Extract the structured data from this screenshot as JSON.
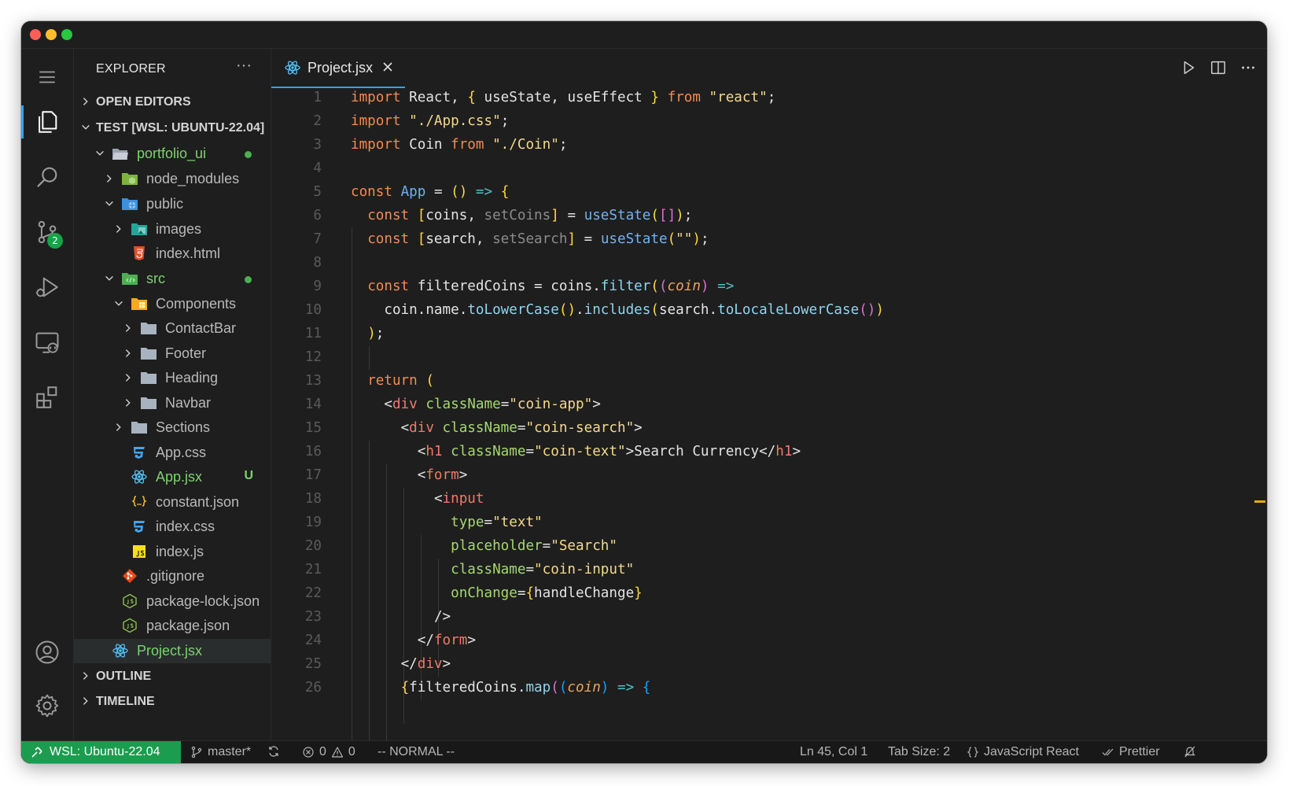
{
  "window": {
    "controls": [
      "close",
      "minimize",
      "maximize"
    ]
  },
  "activity_bar": {
    "items": [
      {
        "name": "menu-icon"
      },
      {
        "name": "explorer-icon",
        "active": true
      },
      {
        "name": "search-icon"
      },
      {
        "name": "source-control-icon",
        "badge": "2"
      },
      {
        "name": "run-debug-icon"
      },
      {
        "name": "remote-explorer-icon"
      },
      {
        "name": "extensions-icon"
      },
      {
        "name": "account-icon"
      },
      {
        "name": "settings-gear-icon"
      }
    ]
  },
  "sidebar": {
    "title": "EXPLORER",
    "more": "···",
    "open_editors": "OPEN EDITORS",
    "workspace": "TEST [WSL: UBUNTU-22.04]",
    "outline": "OUTLINE",
    "timeline": "TIMELINE",
    "tree": [
      {
        "label": "portfolio_ui",
        "icon": "folder-open-icon",
        "expanded": true,
        "dot": true
      },
      {
        "label": "node_modules",
        "icon": "node-folder-icon",
        "expanded": false
      },
      {
        "label": "public",
        "icon": "public-folder-icon",
        "expanded": true
      },
      {
        "label": "images",
        "icon": "images-folder-icon",
        "expanded": false
      },
      {
        "label": "index.html",
        "icon": "html-file-icon"
      },
      {
        "label": "src",
        "icon": "src-folder-icon",
        "expanded": true,
        "dot": true
      },
      {
        "label": "Components",
        "icon": "components-folder-icon",
        "expanded": true
      },
      {
        "label": "ContactBar",
        "icon": "folder-icon",
        "expanded": false
      },
      {
        "label": "Footer",
        "icon": "folder-icon",
        "expanded": false
      },
      {
        "label": "Heading",
        "icon": "folder-icon",
        "expanded": false
      },
      {
        "label": "Navbar",
        "icon": "folder-icon",
        "expanded": false
      },
      {
        "label": "Sections",
        "icon": "folder-icon",
        "expanded": false
      },
      {
        "label": "App.css",
        "icon": "css-file-icon"
      },
      {
        "label": "App.jsx",
        "icon": "react-file-icon",
        "status": "U"
      },
      {
        "label": "constant.json",
        "icon": "json-file-icon"
      },
      {
        "label": "index.css",
        "icon": "css-file-icon"
      },
      {
        "label": "index.js",
        "icon": "js-file-icon"
      },
      {
        "label": ".gitignore",
        "icon": "git-file-icon"
      },
      {
        "label": "package-lock.json",
        "icon": "npm-file-icon"
      },
      {
        "label": "package.json",
        "icon": "npm-file-icon"
      },
      {
        "label": "Project.jsx",
        "icon": "react-file-icon",
        "selected": true
      }
    ]
  },
  "editor": {
    "tab": {
      "label": "Project.jsx",
      "icon": "react-file-icon"
    },
    "toolbar": [
      "run-icon",
      "split-editor-icon",
      "more-actions-icon"
    ],
    "line_numbers": [
      "1",
      "2",
      "3",
      "4",
      "5",
      "6",
      "7",
      "8",
      "9",
      "10",
      "11",
      "12",
      "13",
      "14",
      "15",
      "16",
      "17",
      "18",
      "19",
      "20",
      "21",
      "22",
      "23",
      "24",
      "25",
      "26"
    ],
    "lines": [
      "import React, { useState, useEffect } from \"react\";",
      "import \"./App.css\";",
      "import Coin from \"./Coin\";",
      "",
      "const App = () => {",
      "  const [coins, setCoins] = useState([]);",
      "  const [search, setSearch] = useState(\"\");",
      "",
      "  const filteredCoins = coins.filter((coin) =>",
      "    coin.name.toLowerCase().includes(search.toLocaleLowerCase())",
      "  );",
      "",
      "  return (",
      "    <div className=\"coin-app\">",
      "      <div className=\"coin-search\">",
      "        <h1 className=\"coin-text\">Search Currency</h1>",
      "        <form>",
      "          <input",
      "            type=\"text\"",
      "            placeholder=\"Search\"",
      "            className=\"coin-input\"",
      "            onChange={handleChange}",
      "          />",
      "        </form>",
      "      </div>",
      "      {filteredCoins.map((coin) => {"
    ]
  },
  "status_bar": {
    "remote": "WSL: Ubuntu-22.04",
    "branch": "master*",
    "errors": "0",
    "warnings": "0",
    "vim_mode": "-- NORMAL --",
    "cursor": "Ln 45, Col 1",
    "tab_size": "Tab Size: 2",
    "language": "JavaScript React",
    "formatter": "Prettier"
  },
  "colors": {
    "accent": "#2ea3f2",
    "remote_bg": "#1b9c4e",
    "keyword": "#f28b54",
    "string": "#f5d98b",
    "tag": "#f07a6a",
    "attribute": "#a5d86f"
  }
}
